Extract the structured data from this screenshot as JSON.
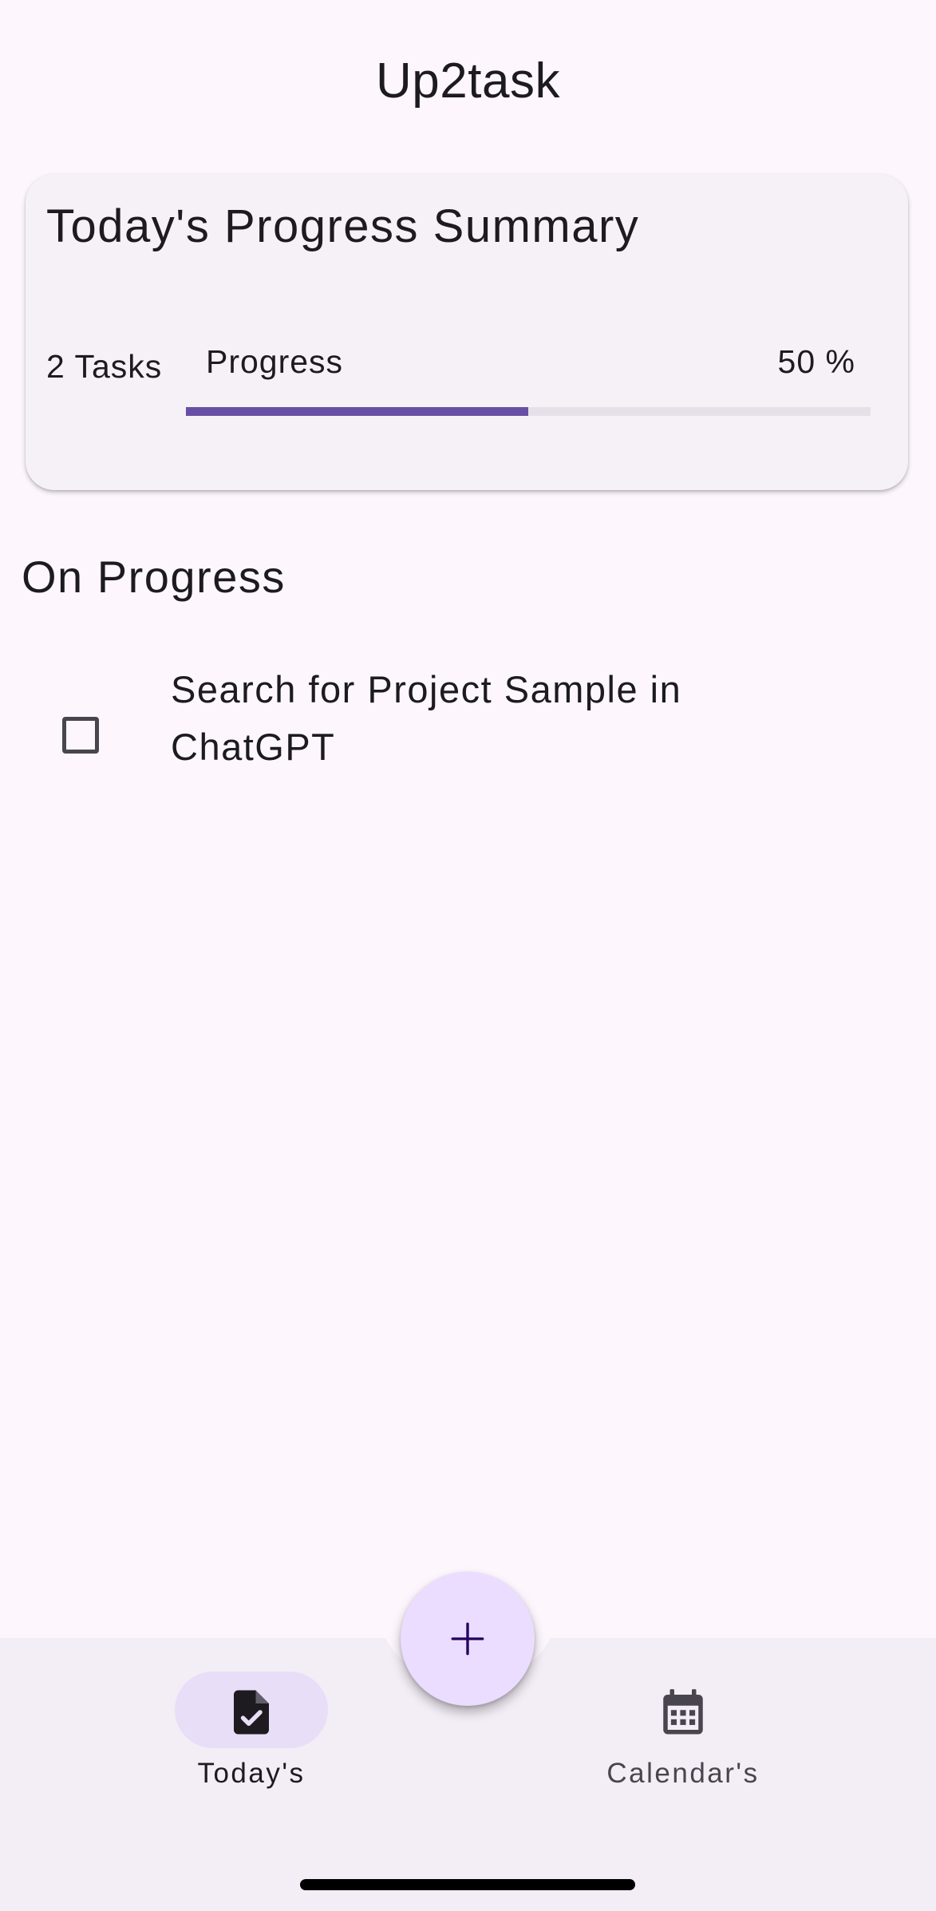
{
  "app": {
    "title": "Up2task"
  },
  "summary": {
    "title": "Today's Progress Summary",
    "tasks_count": "2 Tasks",
    "progress_label": "Progress",
    "progress_percent": "50 %",
    "progress_fraction": 0.5
  },
  "on_progress": {
    "title": "On Progress",
    "tasks": [
      {
        "text": "Search for Project Sample in ChatGPT",
        "checked": false
      }
    ]
  },
  "fab": {
    "icon": "plus-icon"
  },
  "bottom_nav": {
    "items": [
      {
        "label": "Today's",
        "icon": "task-document-check-icon",
        "selected": true
      },
      {
        "label": "Calendar's",
        "icon": "calendar-icon",
        "selected": false
      }
    ]
  },
  "colors": {
    "background": "#fdf7fd",
    "card": "#f6f1f7",
    "accent": "#6750a4",
    "fab": "#eaddff",
    "nav_bar": "#f3edf6",
    "nav_selected_pill": "#e8def8"
  }
}
